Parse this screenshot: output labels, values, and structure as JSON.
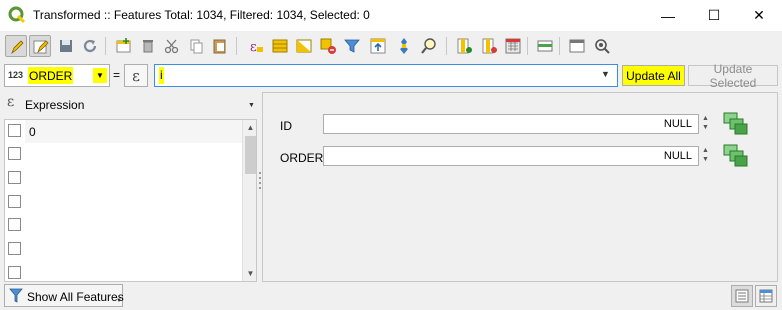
{
  "window": {
    "title": "Transformed :: Features Total: 1034, Filtered: 1034, Selected: 0",
    "minimize_glyph": "—",
    "maximize_glyph": "☐",
    "close_glyph": "✕"
  },
  "toolbar": {
    "buttons": [
      {
        "name": "toggle-editing-icon",
        "active": true
      },
      {
        "name": "multi-edit-icon",
        "active": true
      },
      {
        "name": "save-edits-icon",
        "active": false
      },
      {
        "name": "reload-icon",
        "active": false
      },
      {
        "name": "add-feature-icon",
        "active": false
      },
      {
        "name": "delete-feature-icon",
        "active": false
      },
      {
        "name": "cut-icon",
        "active": false
      },
      {
        "name": "copy-icon",
        "active": false
      },
      {
        "name": "paste-icon",
        "active": false
      },
      {
        "name": "select-by-expression-icon",
        "active": false
      },
      {
        "name": "select-all-icon",
        "active": false
      },
      {
        "name": "invert-selection-icon",
        "active": false
      },
      {
        "name": "deselect-all-icon",
        "active": false
      },
      {
        "name": "filter-select-icon",
        "active": false
      },
      {
        "name": "move-selection-top-icon",
        "active": false
      },
      {
        "name": "pan-to-selection-icon",
        "active": false
      },
      {
        "name": "zoom-to-selection-icon",
        "active": false
      },
      {
        "name": "new-field-icon",
        "active": false
      },
      {
        "name": "delete-field-icon",
        "active": false
      },
      {
        "name": "field-calculator-icon",
        "active": false
      },
      {
        "name": "conditional-formatting-icon",
        "active": false
      },
      {
        "name": "dock-table-icon",
        "active": false
      },
      {
        "name": "actions-icon",
        "active": false
      }
    ]
  },
  "fieldbar": {
    "field_type": "123",
    "field_name": "ORDER",
    "equals": "=",
    "expression_glyph": "ε",
    "expression_value": "i",
    "update_all_label": "Update All",
    "update_selected_label": "Update Selected"
  },
  "left_panel": {
    "expression_label": "Expression",
    "rows": [
      "0",
      "",
      "",
      "",
      "",
      "",
      ""
    ]
  },
  "form": {
    "fields": [
      {
        "label": "ID",
        "value": "NULL"
      },
      {
        "label": "ORDER",
        "value": "NULL"
      }
    ]
  },
  "bottom": {
    "show_all_label": "Show All Features"
  },
  "colors": {
    "highlight": "#ffff00",
    "focus_border": "#3b8ee8",
    "qgis_green": "#589632"
  }
}
